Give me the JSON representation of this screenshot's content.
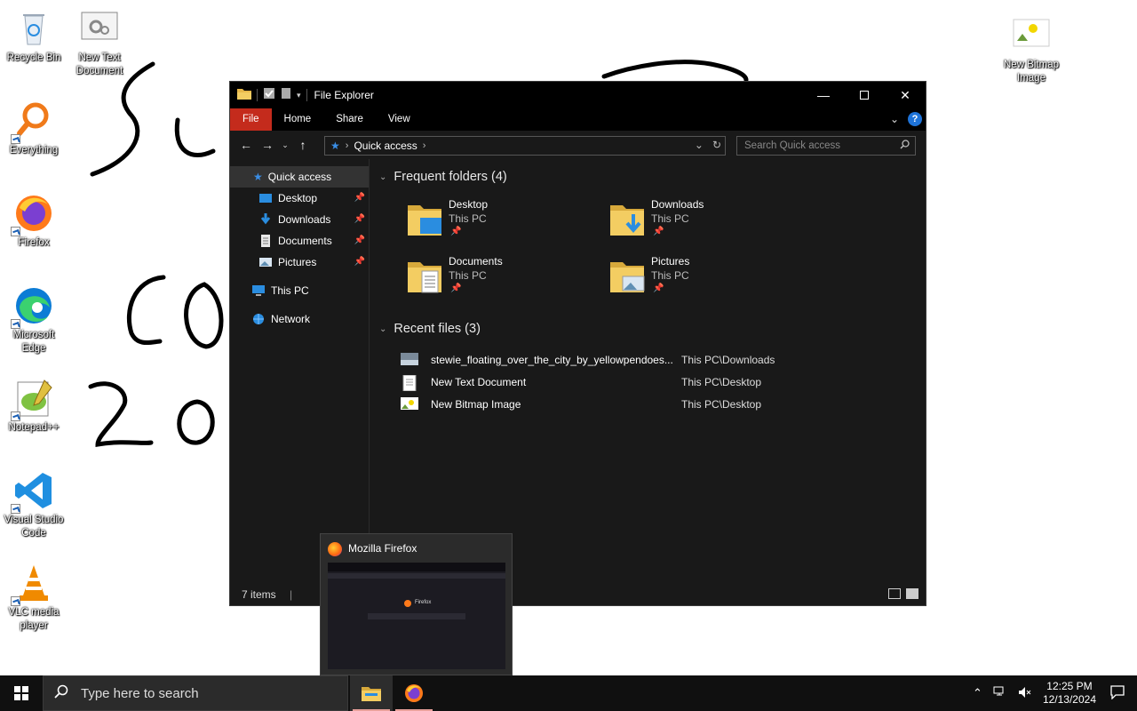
{
  "desktop": {
    "icons": [
      {
        "label": "Recycle Bin"
      },
      {
        "label": "New Text\nDocument"
      },
      {
        "label": "Everything"
      },
      {
        "label": "Firefox"
      },
      {
        "label": "Microsoft\nEdge"
      },
      {
        "label": "Notepad++"
      },
      {
        "label": "Visual Studio\nCode"
      },
      {
        "label": "VLC media\nplayer"
      },
      {
        "label": "New Bitmap\nImage"
      }
    ]
  },
  "explorer": {
    "title": "File Explorer",
    "ribbon_tabs": [
      "File",
      "Home",
      "Share",
      "View"
    ],
    "address": "Quick access",
    "search_placeholder": "Search Quick access",
    "nav": [
      {
        "label": "Quick access"
      },
      {
        "label": "Desktop"
      },
      {
        "label": "Downloads"
      },
      {
        "label": "Documents"
      },
      {
        "label": "Pictures"
      },
      {
        "label": "This PC"
      },
      {
        "label": "Network"
      }
    ],
    "frequent_header": "Frequent folders (4)",
    "folders": [
      {
        "name": "Desktop",
        "location": "This PC"
      },
      {
        "name": "Downloads",
        "location": "This PC"
      },
      {
        "name": "Documents",
        "location": "This PC"
      },
      {
        "name": "Pictures",
        "location": "This PC"
      }
    ],
    "recent_header": "Recent files (3)",
    "recent": [
      {
        "name": "stewie_floating_over_the_city_by_yellowpendoes...",
        "path": "This PC\\Downloads"
      },
      {
        "name": "New Text Document",
        "path": "This PC\\Desktop"
      },
      {
        "name": "New Bitmap Image",
        "path": "This PC\\Desktop"
      }
    ],
    "status": "7 items"
  },
  "thumbnail": {
    "title": "Mozilla Firefox",
    "preview_label": "Firefox"
  },
  "taskbar": {
    "search_placeholder": "Type here to search",
    "time": "12:25 PM",
    "date": "12/13/2024"
  },
  "colors": {
    "file_tab": "#c42b1c",
    "accent": "#1e73d8"
  }
}
